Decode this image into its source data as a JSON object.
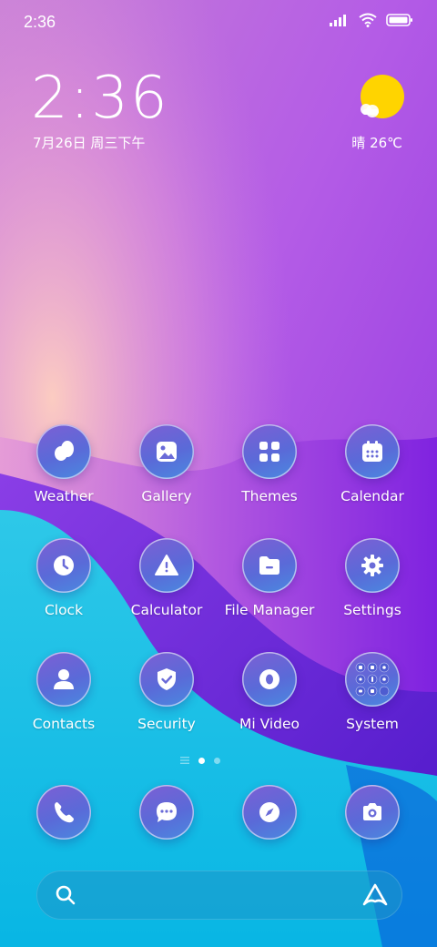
{
  "status_bar": {
    "time": "2:36"
  },
  "lockclock": {
    "time": "2:36",
    "date": "7月26日 周三下午"
  },
  "weather": {
    "text": "晴 26℃"
  },
  "apps": {
    "weather": "Weather",
    "gallery": "Gallery",
    "themes": "Themes",
    "calendar": "Calendar",
    "clock": "Clock",
    "calculator": "Calculator",
    "file_manager": "File Manager",
    "settings": "Settings",
    "contacts": "Contacts",
    "security": "Security",
    "mi_video": "Mi Video",
    "system": "System"
  },
  "dock": [
    "phone-icon",
    "messages-icon",
    "browser-icon",
    "camera-icon"
  ],
  "page_indicator": {
    "pages": 2,
    "current": 1
  },
  "colors": {
    "accent": "#5a6ad8",
    "sun": "#ffd400"
  }
}
